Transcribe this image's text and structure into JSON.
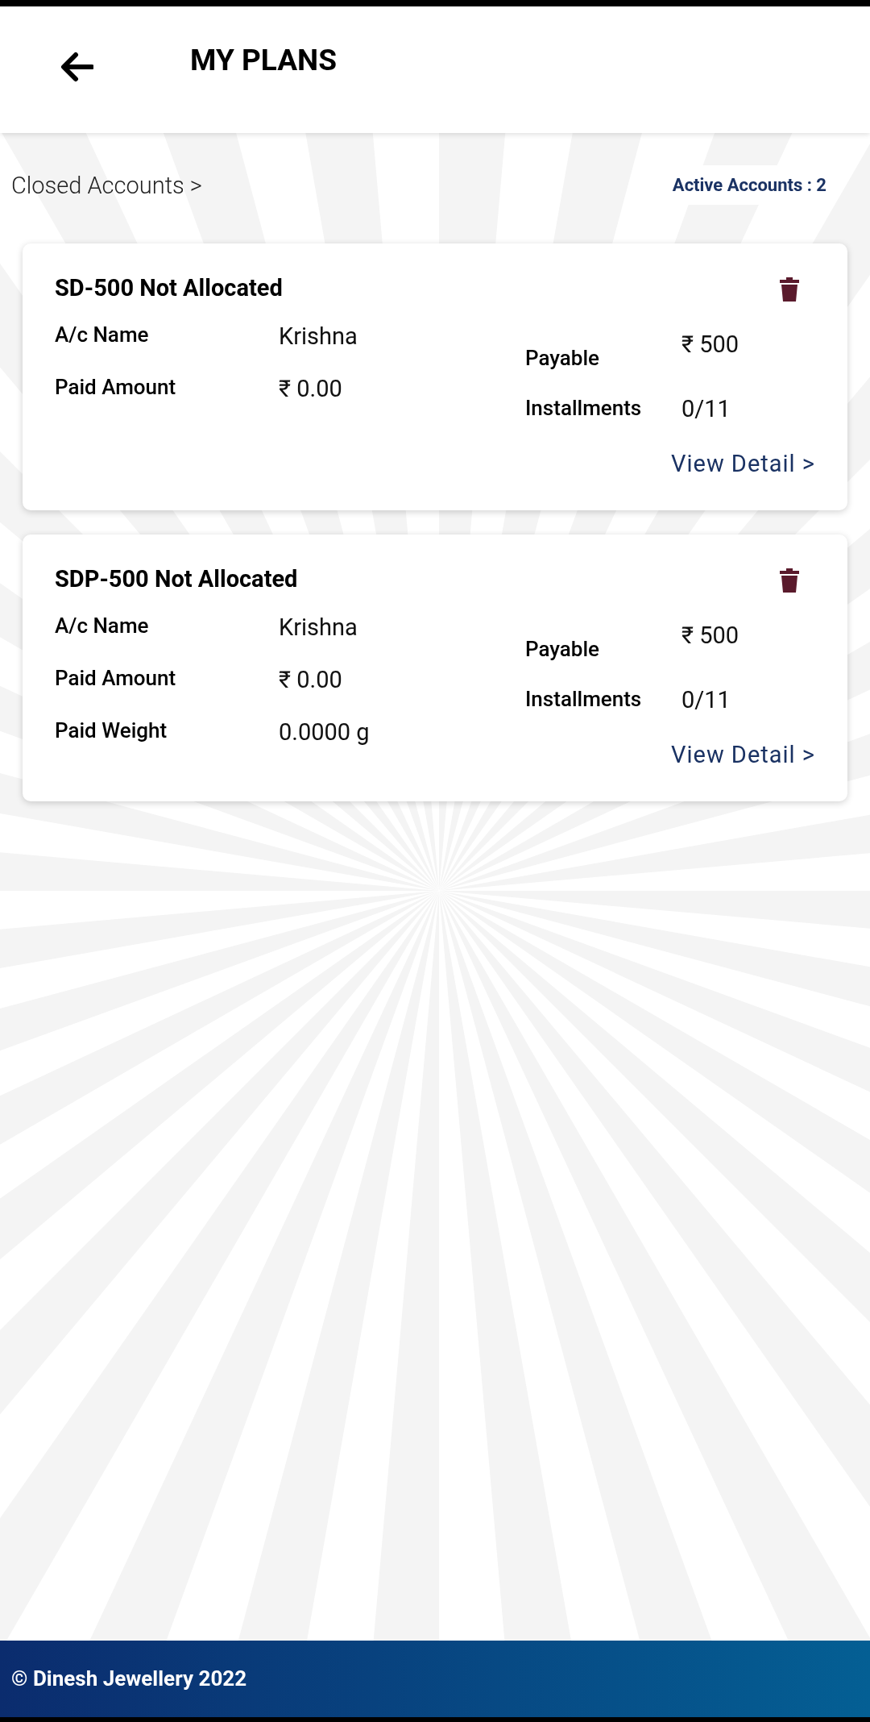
{
  "header": {
    "title": "MY PLANS"
  },
  "closed_link": "Closed Accounts >",
  "active_badge": "Active Accounts : 2",
  "plans": [
    {
      "title": "SD-500 Not Allocated",
      "left": [
        {
          "label": "A/c Name",
          "value": "Krishna"
        },
        {
          "label": "Paid Amount",
          "value": "₹ 0.00"
        }
      ],
      "right": [
        {
          "label": "Payable",
          "value": "₹ 500"
        },
        {
          "label": "Installments",
          "value": "0/11"
        }
      ],
      "link": "View Detail >"
    },
    {
      "title": "SDP-500 Not Allocated",
      "left": [
        {
          "label": "A/c Name",
          "value": "Krishna"
        },
        {
          "label": "Paid Amount",
          "value": "₹ 0.00"
        },
        {
          "label": "Paid Weight",
          "value": "0.0000 g"
        }
      ],
      "right": [
        {
          "label": "Payable",
          "value": "₹ 500"
        },
        {
          "label": "Installments",
          "value": "0/11"
        }
      ],
      "link": "View Detail >"
    }
  ],
  "footer": "© Dinesh Jewellery 2022"
}
